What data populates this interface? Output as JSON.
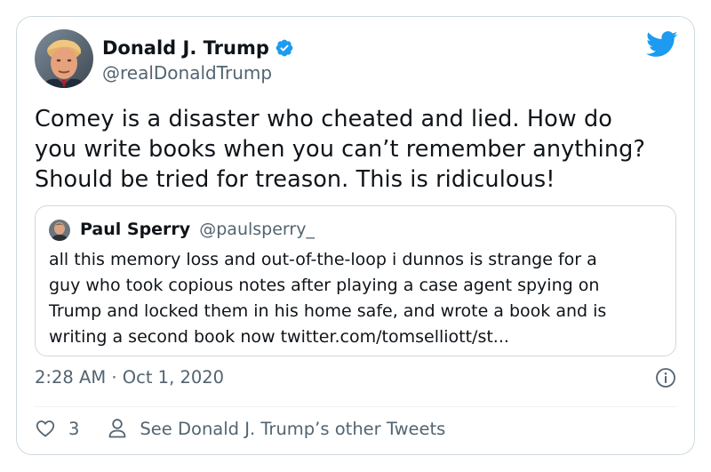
{
  "colors": {
    "twitter_blue": "#1d9bf0",
    "text_primary": "#0f1419",
    "text_secondary": "#536471",
    "border": "#cfd9de"
  },
  "author": {
    "display_name": "Donald J. Trump",
    "handle": "@realDonaldTrump",
    "verified": true,
    "avatar_icon": "profile-photo"
  },
  "tweet": {
    "text": "Comey is a disaster who cheated and lied. How do\nyou write books when you can’t remember anything?\nShould be tried for treason. This is ridiculous!",
    "timestamp": "2:28 AM · Oct 1, 2020"
  },
  "quoted_tweet": {
    "display_name": "Paul Sperry",
    "handle": "@paulsperry_",
    "text": "all this memory loss and out-of-the-loop i dunnos is strange for a\nguy who took copious notes after playing a case agent spying on\nTrump and locked them in his home safe, and wrote a book and is\nwriting a second book now twitter.com/tomselliott/st..."
  },
  "actions": {
    "like_icon": "heart-icon",
    "like_count": "3",
    "profile_icon": "person-icon",
    "other_tweets_label": "See Donald J. Trump’s other Tweets"
  }
}
